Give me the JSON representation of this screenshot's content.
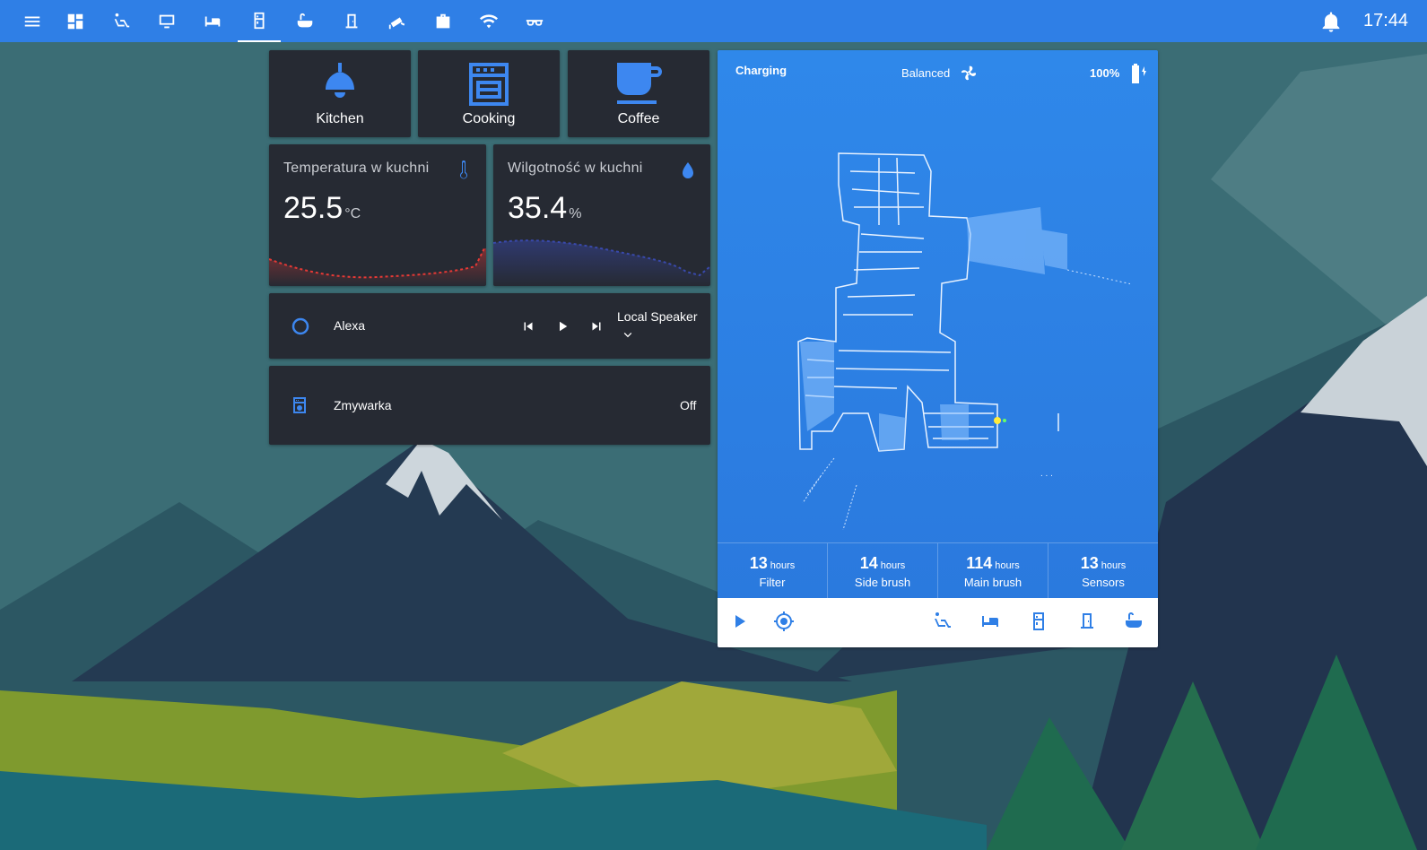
{
  "clock": "17:44",
  "tiles": [
    {
      "label": "Kitchen"
    },
    {
      "label": "Cooking"
    },
    {
      "label": "Coffee"
    }
  ],
  "sensors": {
    "temperature": {
      "title": "Temperatura w kuchni",
      "value": "25.5",
      "unit": "°C"
    },
    "humidity": {
      "title": "Wilgotność w kuchni",
      "value": "35.4",
      "unit": "%"
    }
  },
  "media": {
    "name": "Alexa",
    "source": "Local Speaker"
  },
  "switch": {
    "name": "Zmywarka",
    "state": "Off"
  },
  "vacuum": {
    "status": "Charging",
    "fan_mode": "Balanced",
    "battery": "100%",
    "consumables": [
      {
        "value": "13",
        "unit": "hours",
        "name": "Filter"
      },
      {
        "value": "14",
        "unit": "hours",
        "name": "Side brush"
      },
      {
        "value": "114",
        "unit": "hours",
        "name": "Main brush"
      },
      {
        "value": "13",
        "unit": "hours",
        "name": "Sensors"
      }
    ]
  },
  "colors": {
    "accent": "#2f7fe6",
    "card": "#262a33",
    "temp_line": "#e53935",
    "hum_line": "#3949ab"
  }
}
